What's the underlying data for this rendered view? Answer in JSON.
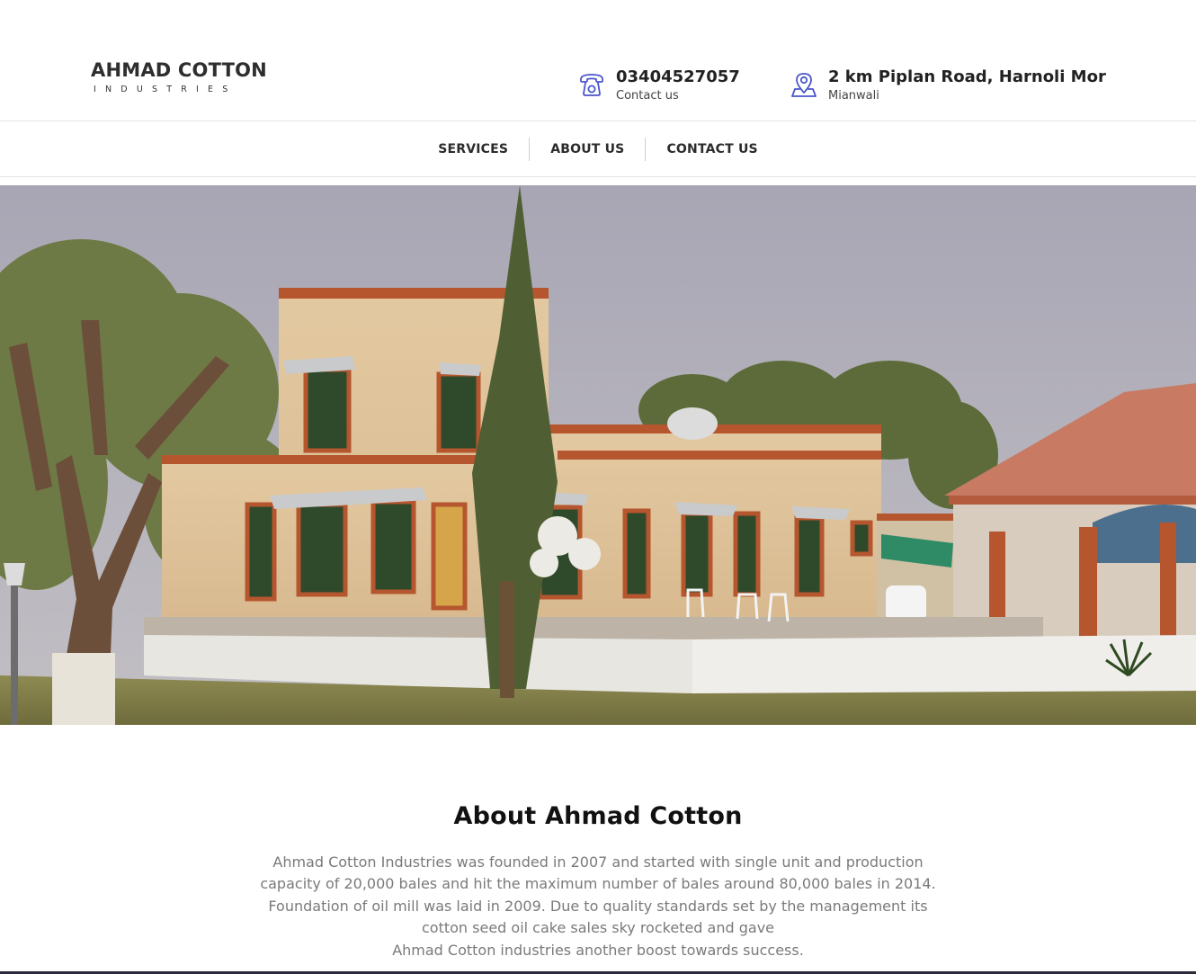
{
  "brand": {
    "name": "AHMAD COTTON",
    "tagline": "INDUSTRIES"
  },
  "contacts": {
    "phone": {
      "icon": "telephone-icon",
      "value": "03404527057",
      "label": "Contact us"
    },
    "address": {
      "icon": "location-pin-icon",
      "value": "2 km Piplan Road, Harnoli Mor",
      "label": "Mianwali"
    }
  },
  "nav": {
    "items": [
      {
        "label": "SERVICES"
      },
      {
        "label": "ABOUT US"
      },
      {
        "label": "CONTACT US"
      }
    ]
  },
  "about": {
    "title": "About Ahmad Cotton",
    "lines": [
      "Ahmad Cotton Industries was founded in 2007 and started with single unit and production",
      "capacity of 20,000 bales and hit the maximum number of bales around 80,000 bales in 2014.",
      "Foundation of oil mill was laid in 2009. Due to quality standards set by the management its",
      "cotton seed oil cake sales sky rocketed and gave",
      "Ahmad Cotton industries another boost towards success."
    ]
  },
  "colors": {
    "icon_accent": "#4a55c9",
    "text_dark": "#222222",
    "body_text": "#7a7a7a"
  }
}
